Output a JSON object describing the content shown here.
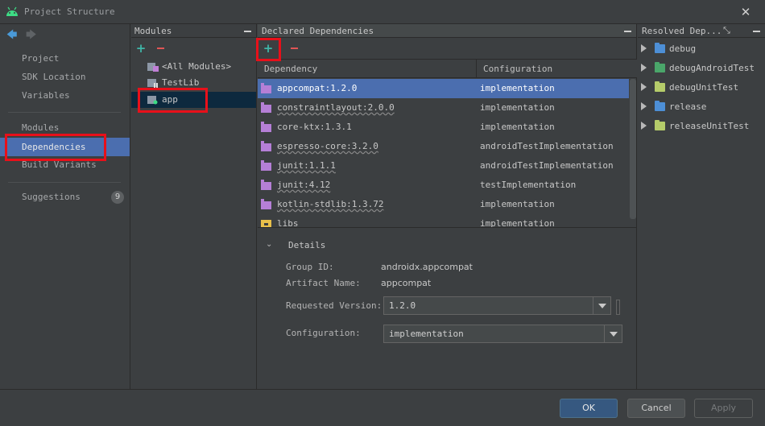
{
  "window": {
    "title": "Project Structure",
    "close_label": "✕"
  },
  "nav": {
    "items": [
      {
        "label": "Project"
      },
      {
        "label": "SDK Location"
      },
      {
        "label": "Variables"
      },
      {
        "label": "Modules"
      },
      {
        "label": "Dependencies",
        "selected": true
      },
      {
        "label": "Build Variants"
      },
      {
        "label": "Suggestions",
        "badge": "9"
      }
    ]
  },
  "modules": {
    "title": "Modules",
    "items": [
      {
        "label": "<All Modules>"
      },
      {
        "label": "TestLib"
      },
      {
        "label": "app",
        "selected": true
      }
    ]
  },
  "declared": {
    "title": "Declared Dependencies",
    "columns": [
      "Dependency",
      "Configuration"
    ],
    "rows": [
      {
        "name": "appcompat:1.2.0",
        "config": "implementation",
        "selected": true
      },
      {
        "name": "constraintlayout:2.0.0",
        "config": "implementation"
      },
      {
        "name": "core-ktx:1.3.1",
        "config": "implementation"
      },
      {
        "name": "espresso-core:3.2.0",
        "config": "androidTestImplementation"
      },
      {
        "name": "junit:1.1.1",
        "config": "androidTestImplementation"
      },
      {
        "name": "junit:4.12",
        "config": "testImplementation"
      },
      {
        "name": "kotlin-stdlib:1.3.72",
        "config": "implementation"
      },
      {
        "name": "libs",
        "config": "implementation"
      }
    ]
  },
  "details": {
    "title": "Details",
    "group_label": "Group ID:",
    "group_value": "androidx.appcompat",
    "artifact_label": "Artifact Name:",
    "artifact_value": "appcompat",
    "version_label": "Requested Version:",
    "version_value": "1.2.0",
    "config_label": "Configuration:",
    "config_value": "implementation"
  },
  "resolved": {
    "title": "Resolved Dep...",
    "items": [
      {
        "label": "debug",
        "color": "#4d8fd6"
      },
      {
        "label": "debugAndroidTest",
        "color": "#4aa66a"
      },
      {
        "label": "debugUnitTest",
        "color": "#b5cc6a"
      },
      {
        "label": "release",
        "color": "#4d8fd6"
      },
      {
        "label": "releaseUnitTest",
        "color": "#b5cc6a"
      }
    ]
  },
  "footer": {
    "ok": "OK",
    "cancel": "Cancel",
    "apply": "Apply"
  },
  "colors": {
    "accent": "#4b6eaf",
    "highlight": "#e8101a",
    "add": "#3fb6a8",
    "remove": "#e05555"
  }
}
